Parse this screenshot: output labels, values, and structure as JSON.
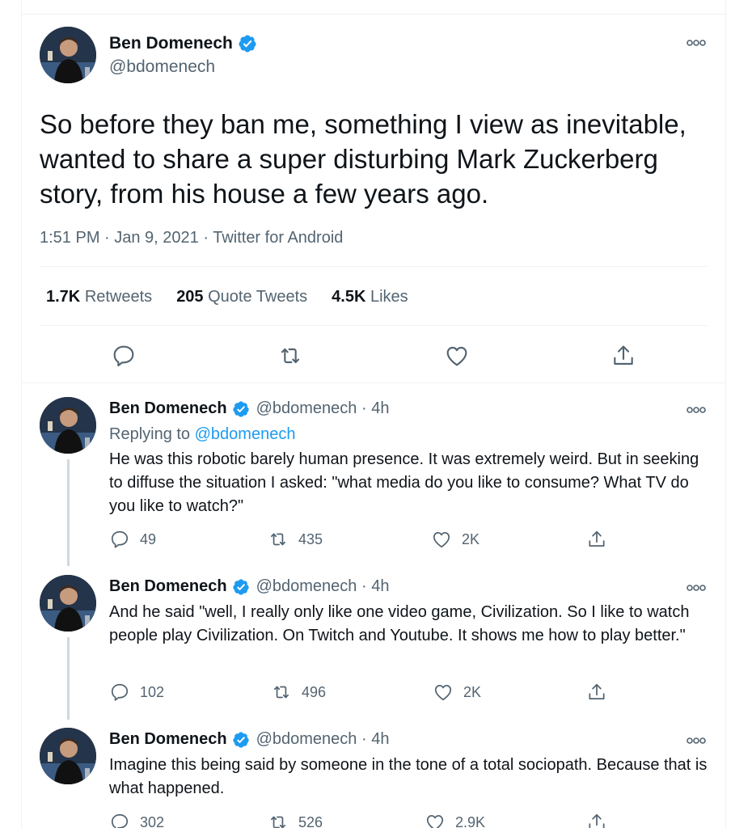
{
  "main_tweet": {
    "name": "Ben Domenech",
    "handle": "@bdomenech",
    "text": "So before they ban me, something I view as inevitable, wanted to share a super disturbing Mark Zuckerberg story, from his house a few years ago.",
    "timestamp": "1:51 PM · Jan 9, 2021 · Twitter for Android",
    "stats": {
      "retweets_count": "1.7K",
      "retweets_label": "Retweets",
      "quotes_count": "205",
      "quotes_label": "Quote Tweets",
      "likes_count": "4.5K",
      "likes_label": "Likes"
    }
  },
  "replies": [
    {
      "name": "Ben Domenech",
      "handle_time": "@bdomenech · 4h",
      "replying_prefix": "Replying to",
      "replying_to": "@bdomenech",
      "text": "He was this robotic barely human presence. It was extremely weird. But in seeking to diffuse the situation I asked: \"what media do you like to consume? What TV do you like to watch?\"",
      "replies": "49",
      "retweets": "435",
      "likes": "2K"
    },
    {
      "name": "Ben Domenech",
      "handle_time": "@bdomenech · 4h",
      "text": "And he said \"well, I really only like one video game, Civilization. So I like to watch people play Civilization. On Twitch and Youtube. It shows me how to play better.\"",
      "replies": "102",
      "retweets": "496",
      "likes": "2K"
    },
    {
      "name": "Ben Domenech",
      "handle_time": "@bdomenech · 4h",
      "text": "Imagine this being said by someone in the tone of a total sociopath. Because that is what happened.",
      "replies": "302",
      "retweets": "526",
      "likes": "2.9K"
    }
  ],
  "colors": {
    "verified": "#1d9bf0",
    "link": "#1d9bf0",
    "muted": "#536471",
    "icon": "#536471"
  }
}
